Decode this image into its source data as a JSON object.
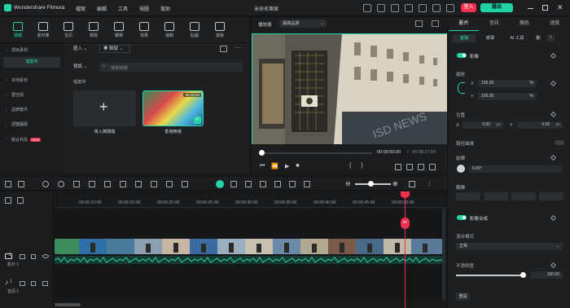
{
  "app": {
    "name": "Wondershare Filmora",
    "project_title": "未命名專案"
  },
  "menu": [
    "檔案",
    "編輯",
    "工具",
    "視圖",
    "幫助"
  ],
  "titlebar_actions": {
    "upgrade": "登入",
    "export": "匯出"
  },
  "media_tabs": [
    {
      "label": "媒體",
      "icon": "media-icon",
      "active": true
    },
    {
      "label": "素材庫",
      "icon": "stock-icon"
    },
    {
      "label": "音訊",
      "icon": "audio-icon"
    },
    {
      "label": "標題",
      "icon": "title-icon"
    },
    {
      "label": "轉場",
      "icon": "transition-icon"
    },
    {
      "label": "效果",
      "icon": "effects-icon"
    },
    {
      "label": "濾鏡",
      "icon": "filter-icon"
    },
    {
      "label": "貼圖",
      "icon": "sticker-icon"
    },
    {
      "label": "樣板",
      "icon": "template-icon"
    }
  ],
  "sidebar": {
    "header": "項目素材",
    "active_item": "檔案夾",
    "items": [
      "本地素材",
      "雲空間",
      "品牌套件",
      "調整圖層",
      "版合共段"
    ],
    "badge": "NEW"
  },
  "media_toolbar": {
    "import": "匯入",
    "record": "錄製",
    "search_placeholder": "搜索媒體",
    "sort": "預設"
  },
  "media_folder": "檔案夾",
  "media_items": [
    {
      "label": "導入媒體檔",
      "type": "import"
    },
    {
      "label": "香港無綫",
      "duration": "00:18:23"
    }
  ],
  "viewer": {
    "player_label": "播放器",
    "quality": "最高品質",
    "current_time": "00:00:50:00",
    "total_time": "00:38:27:00",
    "progress": 0.02
  },
  "right_tabs": [
    "影片",
    "音訊",
    "顏色",
    "速度"
  ],
  "right_subtabs": [
    "基礎",
    "遮罩",
    "AI 工具",
    "動"
  ],
  "right_props": {
    "image_section": "影像",
    "scale_label": "縮放",
    "x_label": "X",
    "x_value": "100.00",
    "y_label": "Y",
    "y_value": "100.00",
    "pct": "%",
    "position_label": "位置",
    "pos_x": "0.00",
    "pos_y": "0.00",
    "px": "px",
    "path_label": "路徑曲線",
    "rotate_label": "旋轉",
    "rotate_value": "0.00°",
    "flip_label": "翻轉",
    "composite_label": "影像合成",
    "blend_label": "混合模式",
    "blend_value": "正常",
    "opacity_label": "不透明度",
    "opacity_value": "100.00",
    "reset_label": "重設"
  },
  "timeline": {
    "ticks": [
      "00:00:10:00",
      "00:00:15:00",
      "00:00:20:00",
      "00:00:25:00",
      "00:00:30:00",
      "00:00:35:00",
      "00:00:40:00",
      "00:00:45:00",
      "00:00:50:00"
    ],
    "video_track": "影片 1",
    "audio_track": "音訊 1",
    "track_num_video": "1",
    "track_num_audio": "1"
  },
  "colors": {
    "accent": "#22d6a5",
    "danger": "#f0304d",
    "playhead": "#f0304d"
  }
}
